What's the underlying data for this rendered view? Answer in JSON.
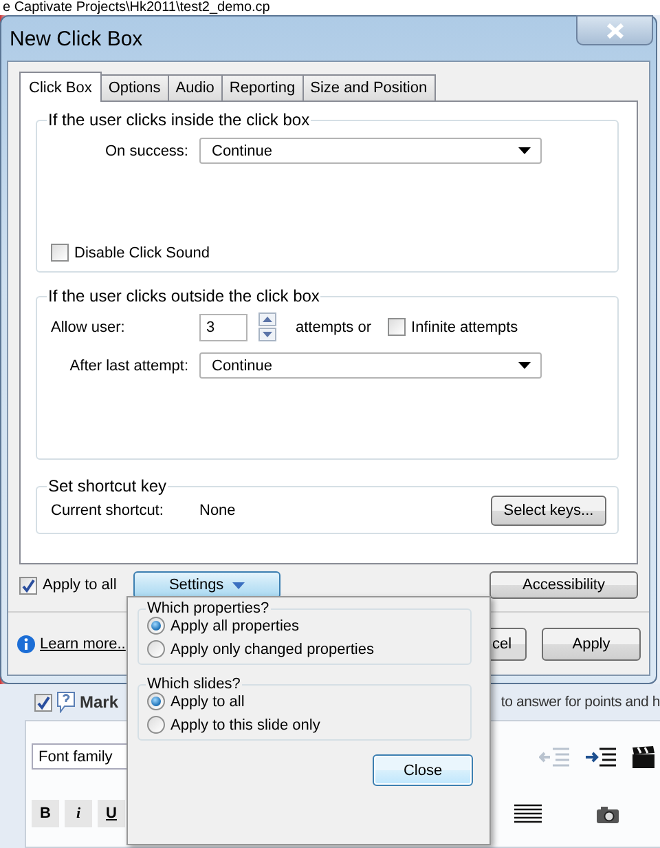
{
  "background": {
    "path_title": "e Captivate Projects\\Hk2011\\test2_demo.cp",
    "question_checkbox": {
      "checked": true
    },
    "mark_label": "Mark",
    "hint_text": "to answer for points and h",
    "font_field": {
      "value": "Font family"
    },
    "format_buttons": [
      {
        "kind": "bold",
        "label": "B"
      },
      {
        "kind": "italic",
        "label": "i"
      },
      {
        "kind": "underline",
        "label": "U"
      }
    ]
  },
  "dialog": {
    "title": "New Click Box",
    "tabs": [
      {
        "label": "Click Box",
        "selected": true
      },
      {
        "label": "Options",
        "selected": false
      },
      {
        "label": "Audio",
        "selected": false
      },
      {
        "label": "Reporting",
        "selected": false
      },
      {
        "label": "Size and Position",
        "selected": false
      }
    ],
    "success_group": {
      "title": "If the user clicks inside the click box",
      "on_success": {
        "label": "On success:",
        "value": "Continue"
      },
      "disable_click_sound": {
        "label": "Disable Click Sound",
        "checked": false
      }
    },
    "failure_group": {
      "title": "If the user clicks outside the click box",
      "allow_user": {
        "label": "Allow user:",
        "value": "3",
        "suffix": "attempts or"
      },
      "infinite_attempts": {
        "label": "Infinite attempts",
        "checked": false
      },
      "after_last_attempt": {
        "label": "After last attempt:",
        "value": "Continue"
      }
    },
    "shortcut_group": {
      "title": "Set shortcut key",
      "label": "Current shortcut:",
      "value": "None",
      "button": "Select keys..."
    },
    "apply_to_all": {
      "label": "Apply to all",
      "checked": true
    },
    "settings_button": {
      "label": "Settings",
      "expanded": true
    },
    "accessibility_button": "Accessibility",
    "learn_more": "Learn more..",
    "cancel_button": "cel",
    "apply_button": "Apply"
  },
  "settings_popup": {
    "groups": [
      {
        "title": "Which properties?",
        "options": [
          {
            "label": "Apply all properties",
            "selected": true
          },
          {
            "label": "Apply only changed properties",
            "selected": false
          }
        ]
      },
      {
        "title": "Which slides?",
        "options": [
          {
            "label": "Apply to all",
            "selected": true
          },
          {
            "label": "Apply to this slide only",
            "selected": false
          }
        ]
      }
    ],
    "close_button": "Close"
  }
}
